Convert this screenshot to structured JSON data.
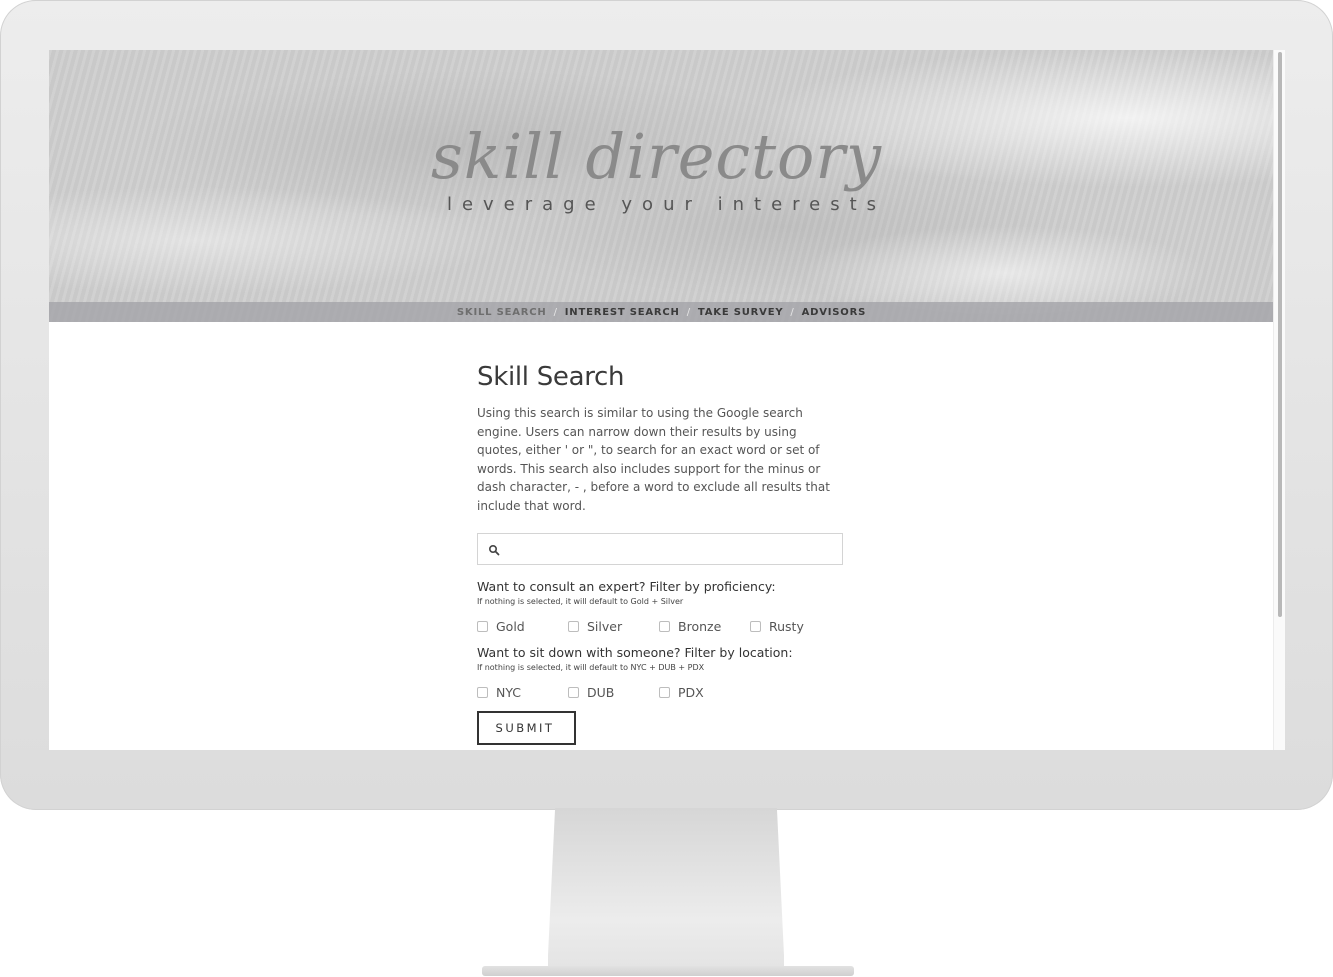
{
  "site": {
    "title": "skill directory",
    "tagline": "leverage your interests"
  },
  "nav": {
    "items": [
      {
        "label": "SKILL SEARCH",
        "active": true
      },
      {
        "label": "INTEREST SEARCH",
        "active": false
      },
      {
        "label": "TAKE SURVEY",
        "active": false
      },
      {
        "label": "ADVISORS",
        "active": false
      }
    ],
    "separator": "/"
  },
  "main": {
    "title": "Skill Search",
    "intro": "Using this search is similar to using the Google search engine. Users can narrow down their results by using quotes, either ' or \", to search for an exact word or set of words. This search also includes support for the minus or dash character, - , before a word to exclude all results that include that word.",
    "search": {
      "value": "",
      "placeholder": "",
      "icon": "search-icon"
    },
    "proficiency": {
      "heading": "Want to consult an expert? Filter by proficiency:",
      "hint": "If nothing is selected, it will default to Gold + Silver",
      "options": [
        "Gold",
        "Silver",
        "Bronze",
        "Rusty"
      ]
    },
    "location": {
      "heading": "Want to sit down with someone? Filter by location:",
      "hint": "If nothing is selected, it will default to NYC + DUB + PDX",
      "options": [
        "NYC",
        "DUB",
        "PDX"
      ]
    },
    "submit_label": "SUBMIT"
  }
}
